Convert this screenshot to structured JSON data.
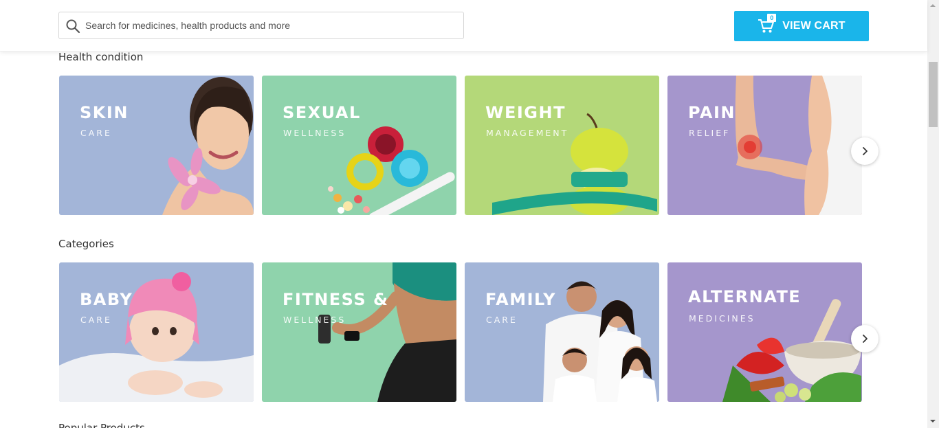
{
  "search": {
    "placeholder": "Search for medicines, health products and more",
    "icon": "search-icon"
  },
  "cart": {
    "label": "VIEW CART",
    "count": "0",
    "icon": "cart-icon"
  },
  "sections": {
    "health": {
      "title": "Health condition",
      "cards": [
        {
          "title": "SKIN",
          "subtitle": "CARE",
          "bg": "#a3b5d8"
        },
        {
          "title": "SEXUAL",
          "subtitle": "WELLNESS",
          "bg": "#8fd3ac"
        },
        {
          "title": "WEIGHT",
          "subtitle": "MANAGEMENT",
          "bg": "#b4d879"
        },
        {
          "title": "PAIN",
          "subtitle": "RELIEF",
          "bg": "#a596cc"
        }
      ]
    },
    "categories": {
      "title": "Categories",
      "cards": [
        {
          "title": "BABY",
          "subtitle": "CARE",
          "bg": "#a3b5d8"
        },
        {
          "title": "FITNESS &",
          "subtitle": "WELLNESS",
          "bg": "#8fd3ac"
        },
        {
          "title": "FAMILY",
          "subtitle": "CARE",
          "bg": "#a3b5d8"
        },
        {
          "title": "ALTERNATE",
          "subtitle": "MEDICINES",
          "bg": "#a596cc"
        }
      ]
    },
    "popular": {
      "title": "Popular Products"
    }
  },
  "colors": {
    "accent": "#1ab5ea"
  }
}
